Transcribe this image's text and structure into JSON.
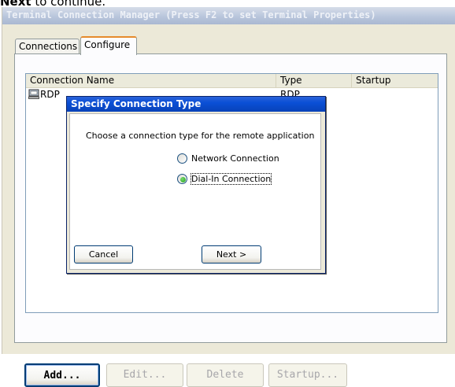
{
  "caption": {
    "bold": "Next",
    "rest": " to continue."
  },
  "window": {
    "title": "Terminal Connection Manager (Press F2 to set Terminal Properties)"
  },
  "tabs": [
    {
      "label": "Connections",
      "active": false
    },
    {
      "label": "Configure",
      "active": true
    }
  ],
  "list": {
    "columns": [
      "Connection Name",
      "Type",
      "Startup"
    ],
    "rows": [
      {
        "name": "RDP",
        "type": "RDP",
        "startup": "",
        "icon": "computer-icon"
      }
    ]
  },
  "dialog": {
    "title": "Specify Connection Type",
    "prompt": "Choose a connection type for the remote application",
    "options": [
      {
        "label": "Network Connection",
        "selected": false
      },
      {
        "label": "Dial-In Connection",
        "selected": true
      }
    ],
    "cancel_label": "Cancel",
    "next_label": "Next >"
  },
  "buttons": {
    "add": "Add...",
    "edit": "Edit...",
    "delete": "Delete",
    "startup": "Startup..."
  },
  "colors": {
    "dialog_title": "#0a4fd6",
    "tab_highlight": "#e68b2c",
    "radio_selected": "#21a121"
  }
}
